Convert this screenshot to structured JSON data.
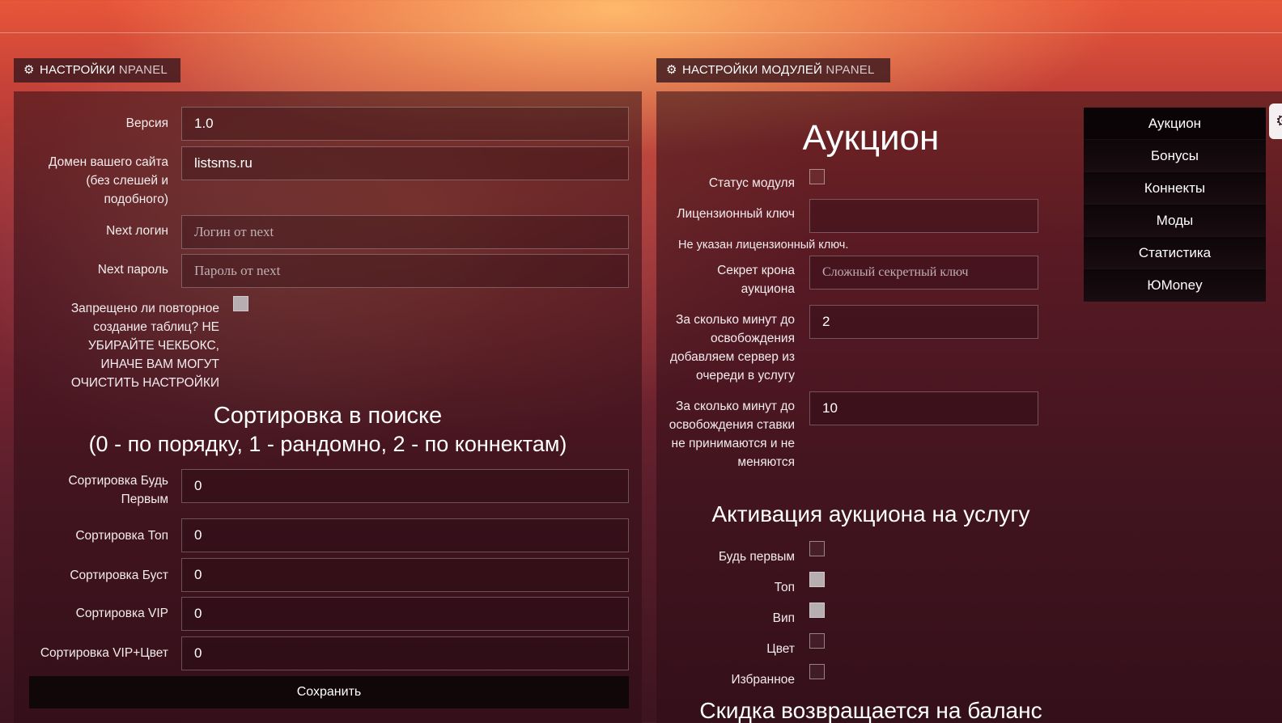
{
  "left_panel": {
    "title": "НАСТРОЙКИ",
    "title_suffix": "NPANEL",
    "fields": {
      "version_label": "Версия",
      "version_value": "1.0",
      "domain_label": "Домен вашего сайта (без слешей и подобного)",
      "domain_value": "listsms.ru",
      "next_login_label": "Next логин",
      "next_login_placeholder": "Логин от next",
      "next_password_label": "Next пароль",
      "next_password_placeholder": "Пароль от next",
      "recreate_label": "Запрещено ли повторное создание таблиц? НЕ УБИРАЙТЕ ЧЕКБОКС, ИНАЧЕ ВАМ МОГУТ ОЧИСТИТЬ НАСТРОЙКИ"
    },
    "sort_heading": "Сортировка в поиске",
    "sort_subheading": "(0 - по порядку, 1 - рандомно, 2 - по коннектам)",
    "sort_fields": [
      {
        "label": "Сортировка Будь Первым",
        "value": "0"
      },
      {
        "label": "Сортировка Топ",
        "value": "0"
      },
      {
        "label": "Сортировка Буст",
        "value": "0"
      },
      {
        "label": "Сортировка VIP",
        "value": "0"
      },
      {
        "label": "Сортировка VIP+Цвет",
        "value": "0"
      }
    ],
    "save_label": "Сохранить"
  },
  "right_panel": {
    "title": "НАСТРОЙКИ МОДУЛЕЙ",
    "title_suffix": "NPANEL",
    "module_title": "Аукцион",
    "status_label": "Статус модуля",
    "license_label": "Лицензионный ключ",
    "license_value": "",
    "license_warning": "Не указан лицензионный ключ.",
    "cron_secret_label": "Секрет крона аукциона",
    "cron_secret_placeholder": "Сложный секретный ключ",
    "minutes_add_label": "За сколько минут до освобождения добавляем сервер из очереди в услугу",
    "minutes_add_value": "2",
    "minutes_bids_label": "За сколько минут до освобождения ставки не принимаются и не меняются",
    "minutes_bids_value": "10",
    "activation_heading": "Активация аукциона на услугу",
    "activation_options": [
      {
        "label": "Будь первым",
        "checked": false
      },
      {
        "label": "Топ",
        "checked": true
      },
      {
        "label": "Вип",
        "checked": true
      },
      {
        "label": "Цвет",
        "checked": false
      },
      {
        "label": "Избранное",
        "checked": false
      }
    ],
    "discount_heading": "Скидка возвращается на баланс"
  },
  "side_nav": {
    "items": [
      "Аукцион",
      "Бонусы",
      "Коннекты",
      "Моды",
      "Статистика",
      "ЮMoney"
    ]
  },
  "icons": {
    "gear": "gear-icon"
  }
}
